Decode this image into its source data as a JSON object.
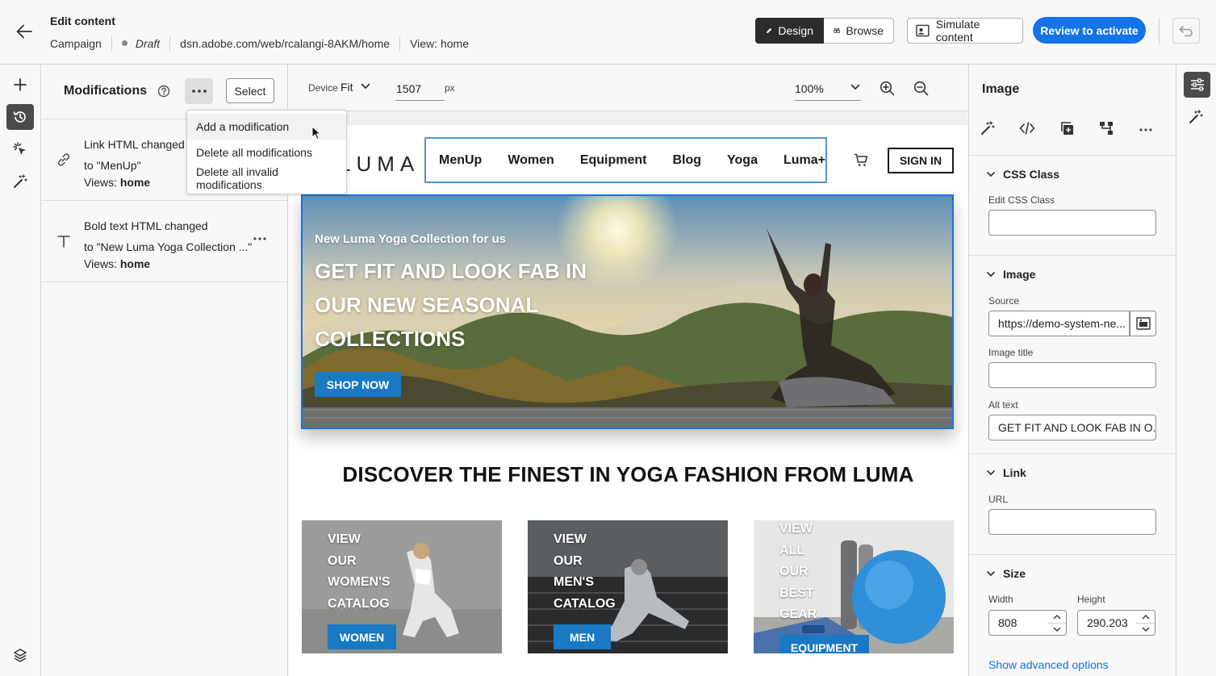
{
  "header": {
    "title": "Edit content",
    "campaign_label": "Campaign",
    "status": "Draft",
    "url": "dsn.adobe.com/web/rcalangi-8AKM/home",
    "view": "View: home",
    "design_label": "Design",
    "browse_label": "Browse",
    "simulate_label": "Simulate content",
    "review_label": "Review to activate"
  },
  "modifications": {
    "title": "Modifications",
    "select_label": "Select",
    "menu": [
      "Add a modification",
      "Delete all modifications",
      "Delete all invalid modifications"
    ],
    "items": [
      {
        "line1": "Link HTML changed",
        "line2": "to \"MenUp\"",
        "views_label": "Views:",
        "views_value": "home"
      },
      {
        "line1": "Bold text HTML changed",
        "line2": "to \"New Luma Yoga Collection ...\"",
        "views_label": "Views:",
        "views_value": "home"
      }
    ]
  },
  "canvas": {
    "device_label": "Device",
    "device_value": "Fit",
    "width_value": "1507",
    "width_unit": "px",
    "zoom_value": "100%"
  },
  "site": {
    "logo": "LUMA",
    "nav": [
      "MenUp",
      "Women",
      "Equipment",
      "Blog",
      "Yoga",
      "Luma+"
    ],
    "signin": "SIGN IN",
    "hero_kicker": "New Luma Yoga Collection for us",
    "hero_heading": "GET FIT AND LOOK FAB IN OUR NEW SEASONAL COLLECTIONS",
    "shop_now": "SHOP NOW",
    "discover": "DISCOVER THE FINEST IN YOGA FASHION FROM LUMA",
    "cards": [
      {
        "lines": [
          "VIEW",
          "OUR",
          "WOMEN'S",
          "CATALOG"
        ],
        "button": "WOMEN"
      },
      {
        "lines": [
          "VIEW",
          "OUR",
          "MEN'S",
          "CATALOG"
        ],
        "button": "MEN"
      },
      {
        "lines": [
          "VIEW",
          "ALL",
          "OUR",
          "BEST",
          "GEAR"
        ],
        "button": "EQUIPMENT"
      }
    ]
  },
  "properties": {
    "title": "Image",
    "css_section": "CSS Class",
    "css_label": "Edit CSS Class",
    "css_value": "",
    "image_section": "Image",
    "source_label": "Source",
    "source_value": "https://demo-system-ne...",
    "image_title_label": "Image title",
    "image_title_value": "",
    "alt_label": "Alt text",
    "alt_value": "GET FIT AND LOOK FAB IN O...",
    "link_section": "Link",
    "url_label": "URL",
    "url_value": "",
    "size_section": "Size",
    "width_label": "Width",
    "width_value": "808",
    "height_label": "Height",
    "height_value": "290.203",
    "advanced_link": "Show advanced options"
  },
  "colors": {
    "accent": "#1473e6",
    "luma_blue": "#1979c3",
    "dark": "#2c2c2c"
  }
}
